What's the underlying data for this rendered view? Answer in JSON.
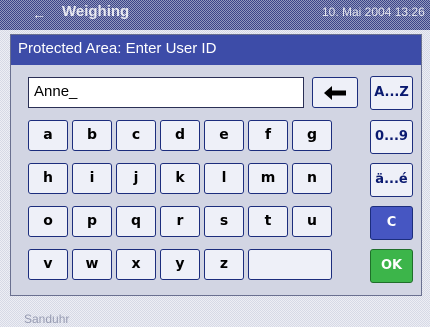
{
  "background": {
    "title": "Weighing",
    "datetime": "10. Mai 2004  13:26",
    "status": "Sanduhr"
  },
  "dialog": {
    "title": "Protected Area: Enter User ID",
    "input_value": "Anne_",
    "backspace_icon": "left-arrow-backspace-icon",
    "keys": {
      "row1": [
        "a",
        "b",
        "c",
        "d",
        "e",
        "f",
        "g"
      ],
      "row2": [
        "h",
        "i",
        "j",
        "k",
        "l",
        "m",
        "n"
      ],
      "row3": [
        "o",
        "p",
        "q",
        "r",
        "s",
        "t",
        "u"
      ],
      "row4": [
        "v",
        "w",
        "x",
        "y",
        "z"
      ]
    },
    "side_buttons": {
      "alpha": "A...Z",
      "numeric": "0...9",
      "special": "ä...é",
      "clear": "C",
      "ok": "OK"
    }
  },
  "colors": {
    "title_bar": "#3d4ca8",
    "key_border": "#1c2d7d",
    "ok_button": "#3cb54a",
    "clear_button": "#4656c2"
  }
}
